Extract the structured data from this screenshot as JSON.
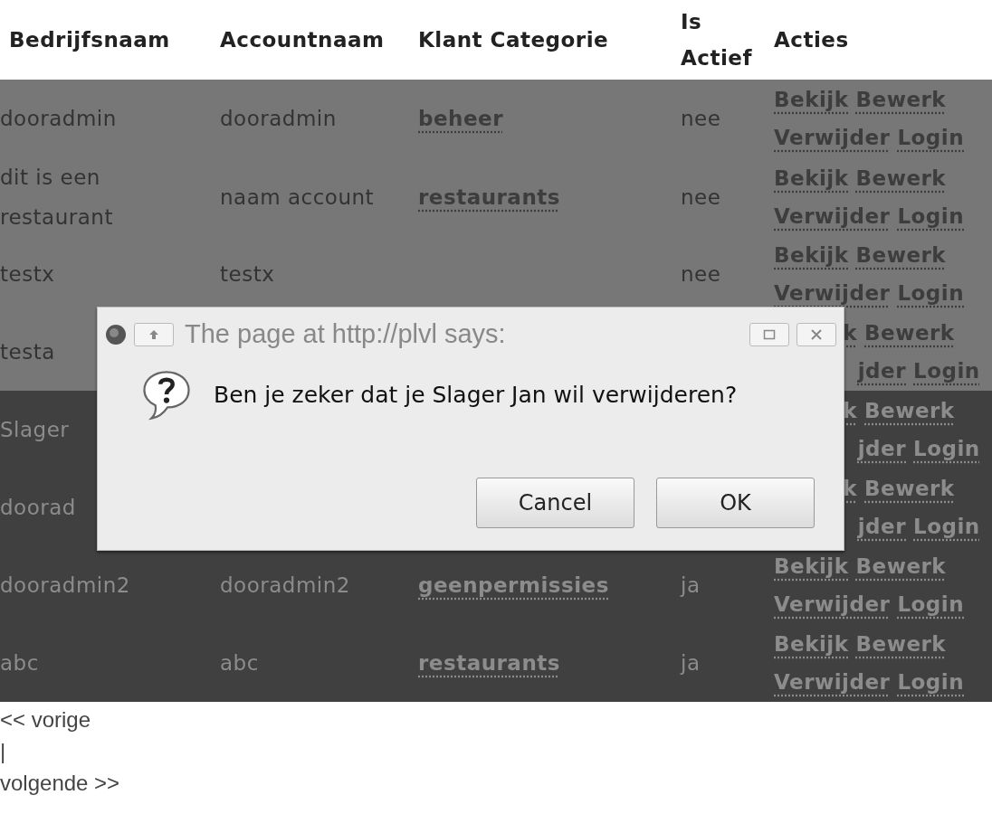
{
  "table": {
    "columns": [
      "Bedrijfsnaam",
      "Accountnaam",
      "Klant Categorie",
      "Is Actief",
      "Acties"
    ],
    "rows": [
      {
        "kind": "light",
        "bedrijfsnaam": "dooradmin",
        "accountnaam": "dooradmin",
        "categorie": "beheer",
        "actief": "nee",
        "acties": [
          {
            "label": "Bekijk",
            "cut": false
          },
          {
            "label": "Bewerk",
            "cut": false
          },
          {
            "label": "Verwijder",
            "cut": false
          },
          {
            "label": "Login",
            "cut": false
          }
        ]
      },
      {
        "kind": "light",
        "bedrijfsnaam": "dit is een restaurant",
        "accountnaam": "naam account",
        "categorie": "restaurants",
        "actief": "nee",
        "acties": [
          {
            "label": "Bekijk",
            "cut": false
          },
          {
            "label": "Bewerk",
            "cut": false
          },
          {
            "label": "Verwijder",
            "cut": false
          },
          {
            "label": "Login",
            "cut": false
          }
        ]
      },
      {
        "kind": "light",
        "bedrijfsnaam": "testx",
        "accountnaam": "testx",
        "actief": "nee",
        "acties": [
          {
            "label": "Bekijk",
            "cut": false
          },
          {
            "label": "Bewerk",
            "cut": false
          },
          {
            "label": "Verwijder",
            "cut": false
          },
          {
            "label": "Login",
            "cut": false
          }
        ]
      },
      {
        "kind": "light",
        "bedrijfsnaam": "testa",
        "acties": [
          {
            "label": "k",
            "cut": true
          },
          {
            "label": "Bewerk",
            "cut": false
          },
          {
            "label": "jder",
            "cut": true
          },
          {
            "label": "Login",
            "cut": false
          }
        ]
      },
      {
        "kind": "dark",
        "bedrijfsnaam": "Slager",
        "acties": [
          {
            "label": "k",
            "cut": true
          },
          {
            "label": "Bewerk",
            "cut": false
          },
          {
            "label": "jder",
            "cut": true
          },
          {
            "label": "Login",
            "cut": false
          }
        ]
      },
      {
        "kind": "dark",
        "bedrijfsnaam": "doorad",
        "acties": [
          {
            "label": "k",
            "cut": true
          },
          {
            "label": "Bewerk",
            "cut": false
          },
          {
            "label": "jder",
            "cut": true
          },
          {
            "label": "Login",
            "cut": false
          }
        ]
      },
      {
        "kind": "dark",
        "bedrijfsnaam": "dooradmin2",
        "accountnaam": "dooradmin2",
        "categorie": "geenpermissies",
        "actief": "ja",
        "acties": [
          {
            "label": "Bekijk",
            "cut": false
          },
          {
            "label": "Bewerk",
            "cut": false
          },
          {
            "label": "Verwijder",
            "cut": false
          },
          {
            "label": "Login",
            "cut": false
          }
        ]
      },
      {
        "kind": "dark",
        "bedrijfsnaam": "abc",
        "accountnaam": "abc",
        "categorie": "restaurants",
        "actief": "ja",
        "acties": [
          {
            "label": "Bekijk",
            "cut": false
          },
          {
            "label": "Bewerk",
            "cut": false
          },
          {
            "label": "Verwijder",
            "cut": false
          },
          {
            "label": "Login",
            "cut": false
          }
        ]
      }
    ]
  },
  "pagination": [
    "<< vorige",
    "|",
    "volgende >>"
  ],
  "dialog": {
    "title": "The page at http://plvl says:",
    "message": "Ben je zeker dat je Slager Jan wil verwijderen?",
    "buttons": [
      "Cancel",
      "OK"
    ]
  }
}
